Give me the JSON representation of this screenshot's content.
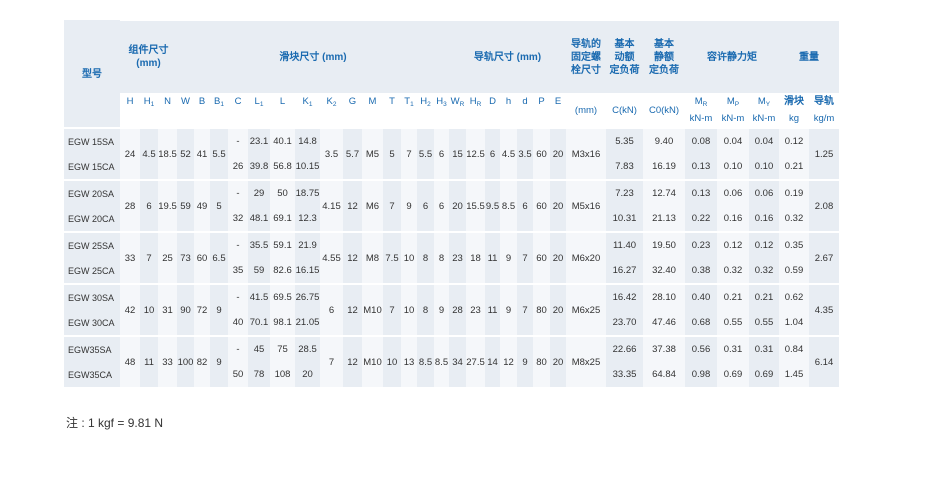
{
  "headers": {
    "model": "型号",
    "group_assembly": "组件尺寸\n(mm)",
    "group_block": "滑块尺寸 (mm)",
    "group_rail": "导轨尺寸 (mm)",
    "rail_bolt": "导轨的\n固定螺\n栓尺寸",
    "dyn_load": "基本\n动额\n定负荷",
    "static_load": "基本\n静额\n定负荷",
    "static_moment": "容许静力矩",
    "weight": "重量",
    "block": "滑块",
    "rail": "导轨",
    "units": {
      "bolt": "(mm)",
      "c": "C(kN)",
      "c0": "C0(kN)",
      "moment": "kN-m",
      "kg": "kg",
      "kgm": "kg/m"
    },
    "sym_assembly": [
      "H",
      "H1",
      "N"
    ],
    "sym_block": [
      "W",
      "B",
      "B1",
      "C",
      "L1",
      "L",
      "K1",
      "K2",
      "G",
      "M",
      "T",
      "T1",
      "H2",
      "H3"
    ],
    "sym_rail": [
      "WR",
      "HR",
      "D",
      "h",
      "d",
      "P",
      "E"
    ],
    "sym_moment": [
      "MR",
      "MP",
      "MY"
    ]
  },
  "groups": [
    {
      "shared": {
        "H": "24",
        "H1": "4.5",
        "N": "18.5",
        "W": "52",
        "B": "41",
        "B1": "5.5",
        "K2": "3.5",
        "G": "5.7",
        "M": "M5",
        "T": "5",
        "T1": "7",
        "H2": "5.5",
        "H3": "6",
        "WR": "15",
        "HR": "12.5",
        "D": "6",
        "h": "4.5",
        "d": "3.5",
        "P": "60",
        "E": "20",
        "bolt": "M3x16",
        "rail_w": "1.25"
      },
      "rows": [
        {
          "model": "EGW 15SA",
          "C": "-",
          "L1": "23.1",
          "L": "40.1",
          "K1": "14.8",
          "Cdyn": "5.35",
          "C0": "9.40",
          "MR": "0.08",
          "MP": "0.04",
          "MY": "0.04",
          "block_w": "0.12"
        },
        {
          "model": "EGW 15CA",
          "C": "26",
          "L1": "39.8",
          "L": "56.8",
          "K1": "10.15",
          "Cdyn": "7.83",
          "C0": "16.19",
          "MR": "0.13",
          "MP": "0.10",
          "MY": "0.10",
          "block_w": "0.21"
        }
      ]
    },
    {
      "shared": {
        "H": "28",
        "H1": "6",
        "N": "19.5",
        "W": "59",
        "B": "49",
        "B1": "5",
        "K2": "4.15",
        "G": "12",
        "M": "M6",
        "T": "7",
        "T1": "9",
        "H2": "6",
        "H3": "6",
        "WR": "20",
        "HR": "15.5",
        "D": "9.5",
        "h": "8.5",
        "d": "6",
        "P": "60",
        "E": "20",
        "bolt": "M5x16",
        "rail_w": "2.08"
      },
      "rows": [
        {
          "model": "EGW 20SA",
          "C": "-",
          "L1": "29",
          "L": "50",
          "K1": "18.75",
          "Cdyn": "7.23",
          "C0": "12.74",
          "MR": "0.13",
          "MP": "0.06",
          "MY": "0.06",
          "block_w": "0.19"
        },
        {
          "model": "EGW 20CA",
          "C": "32",
          "L1": "48.1",
          "L": "69.1",
          "K1": "12.3",
          "Cdyn": "10.31",
          "C0": "21.13",
          "MR": "0.22",
          "MP": "0.16",
          "MY": "0.16",
          "block_w": "0.32"
        }
      ]
    },
    {
      "shared": {
        "H": "33",
        "H1": "7",
        "N": "25",
        "W": "73",
        "B": "60",
        "B1": "6.5",
        "K2": "4.55",
        "G": "12",
        "M": "M8",
        "T": "7.5",
        "T1": "10",
        "H2": "8",
        "H3": "8",
        "WR": "23",
        "HR": "18",
        "D": "11",
        "h": "9",
        "d": "7",
        "P": "60",
        "E": "20",
        "bolt": "M6x20",
        "rail_w": "2.67"
      },
      "rows": [
        {
          "model": "EGW 25SA",
          "C": "-",
          "L1": "35.5",
          "L": "59.1",
          "K1": "21.9",
          "Cdyn": "11.40",
          "C0": "19.50",
          "MR": "0.23",
          "MP": "0.12",
          "MY": "0.12",
          "block_w": "0.35"
        },
        {
          "model": "EGW 25CA",
          "C": "35",
          "L1": "59",
          "L": "82.6",
          "K1": "16.15",
          "Cdyn": "16.27",
          "C0": "32.40",
          "MR": "0.38",
          "MP": "0.32",
          "MY": "0.32",
          "block_w": "0.59"
        }
      ]
    },
    {
      "shared": {
        "H": "42",
        "H1": "10",
        "N": "31",
        "W": "90",
        "B": "72",
        "B1": "9",
        "K2": "6",
        "G": "12",
        "M": "M10",
        "T": "7",
        "T1": "10",
        "H2": "8",
        "H3": "9",
        "WR": "28",
        "HR": "23",
        "D": "11",
        "h": "9",
        "d": "7",
        "P": "80",
        "E": "20",
        "bolt": "M6x25",
        "rail_w": "4.35"
      },
      "rows": [
        {
          "model": "EGW 30SA",
          "C": "-",
          "L1": "41.5",
          "L": "69.5",
          "K1": "26.75",
          "Cdyn": "16.42",
          "C0": "28.10",
          "MR": "0.40",
          "MP": "0.21",
          "MY": "0.21",
          "block_w": "0.62"
        },
        {
          "model": "EGW 30CA",
          "C": "40",
          "L1": "70.1",
          "L": "98.1",
          "K1": "21.05",
          "Cdyn": "23.70",
          "C0": "47.46",
          "MR": "0.68",
          "MP": "0.55",
          "MY": "0.55",
          "block_w": "1.04"
        }
      ]
    },
    {
      "shared": {
        "H": "48",
        "H1": "11",
        "N": "33",
        "W": "100",
        "B": "82",
        "B1": "9",
        "K2": "7",
        "G": "12",
        "M": "M10",
        "T": "10",
        "T1": "13",
        "H2": "8.5",
        "H3": "8.5",
        "WR": "34",
        "HR": "27.5",
        "D": "14",
        "h": "12",
        "d": "9",
        "P": "80",
        "E": "20",
        "bolt": "M8x25",
        "rail_w": "6.14"
      },
      "rows": [
        {
          "model": "EGW35SA",
          "C": "-",
          "L1": "45",
          "L": "75",
          "K1": "28.5",
          "Cdyn": "22.66",
          "C0": "37.38",
          "MR": "0.56",
          "MP": "0.31",
          "MY": "0.31",
          "block_w": "0.84"
        },
        {
          "model": "EGW35CA",
          "C": "50",
          "L1": "78",
          "L": "108",
          "K1": "20",
          "Cdyn": "33.35",
          "C0": "64.84",
          "MR": "0.98",
          "MP": "0.69",
          "MY": "0.69",
          "block_w": "1.45"
        }
      ]
    }
  ],
  "note": "注 : 1 kgf = 9.81 N"
}
